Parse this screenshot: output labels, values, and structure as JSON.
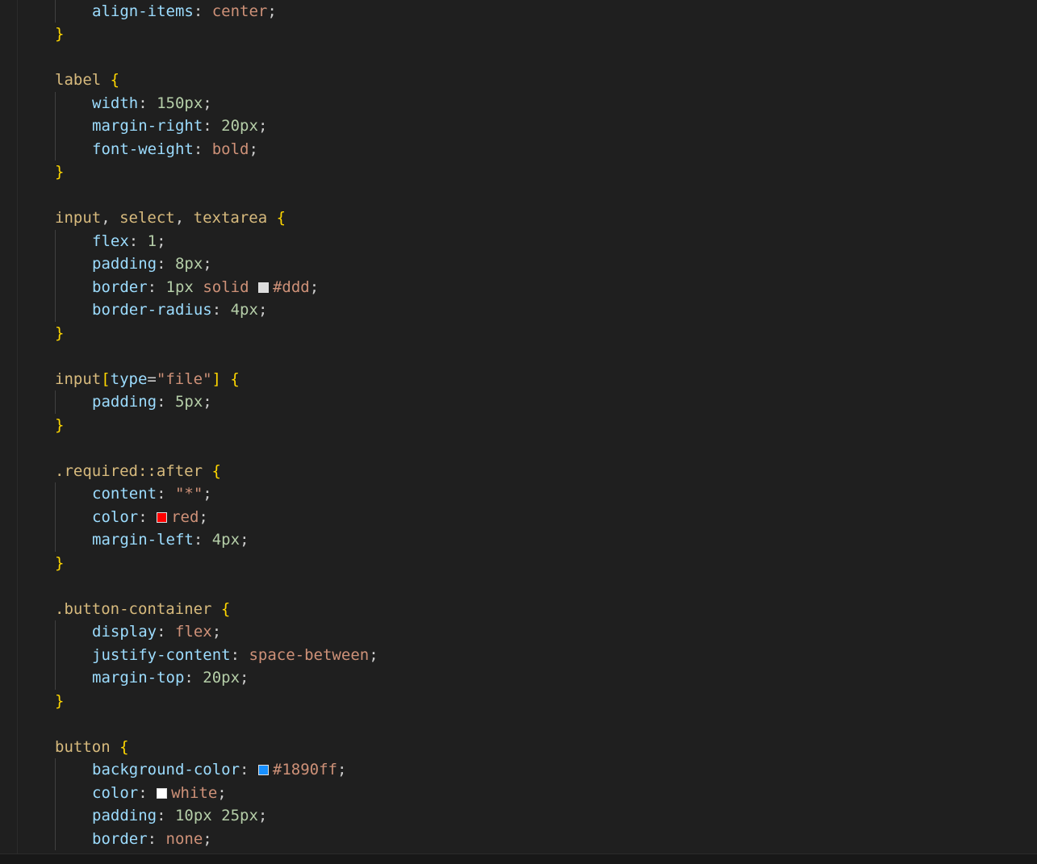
{
  "editor": {
    "language": "css",
    "lines": [
      {
        "id": "l0",
        "indent": 1,
        "tokens": [
          [
            "prop",
            "align-items"
          ],
          [
            "punc",
            ": "
          ],
          [
            "kw",
            "center"
          ],
          [
            "punc",
            ";"
          ]
        ]
      },
      {
        "id": "l1",
        "indent": 0,
        "tokens": [
          [
            "brace",
            "}"
          ]
        ]
      },
      {
        "id": "l2",
        "indent": 0,
        "tokens": []
      },
      {
        "id": "l3",
        "indent": 0,
        "tokens": [
          [
            "tag",
            "label"
          ],
          [
            "punc",
            " "
          ],
          [
            "brace",
            "{"
          ]
        ]
      },
      {
        "id": "l4",
        "indent": 1,
        "tokens": [
          [
            "prop",
            "width"
          ],
          [
            "punc",
            ": "
          ],
          [
            "num",
            "150px"
          ],
          [
            "punc",
            ";"
          ]
        ]
      },
      {
        "id": "l5",
        "indent": 1,
        "tokens": [
          [
            "prop",
            "margin-right"
          ],
          [
            "punc",
            ": "
          ],
          [
            "num",
            "20px"
          ],
          [
            "punc",
            ";"
          ]
        ]
      },
      {
        "id": "l6",
        "indent": 1,
        "tokens": [
          [
            "prop",
            "font-weight"
          ],
          [
            "punc",
            ": "
          ],
          [
            "kw",
            "bold"
          ],
          [
            "punc",
            ";"
          ]
        ]
      },
      {
        "id": "l7",
        "indent": 0,
        "tokens": [
          [
            "brace",
            "}"
          ]
        ]
      },
      {
        "id": "l8",
        "indent": 0,
        "tokens": []
      },
      {
        "id": "l9",
        "indent": 0,
        "tokens": [
          [
            "tag",
            "input"
          ],
          [
            "punc",
            ", "
          ],
          [
            "tag",
            "select"
          ],
          [
            "punc",
            ", "
          ],
          [
            "tag",
            "textarea"
          ],
          [
            "punc",
            " "
          ],
          [
            "brace",
            "{"
          ]
        ]
      },
      {
        "id": "l10",
        "indent": 1,
        "tokens": [
          [
            "prop",
            "flex"
          ],
          [
            "punc",
            ": "
          ],
          [
            "num",
            "1"
          ],
          [
            "punc",
            ";"
          ]
        ]
      },
      {
        "id": "l11",
        "indent": 1,
        "tokens": [
          [
            "prop",
            "padding"
          ],
          [
            "punc",
            ": "
          ],
          [
            "num",
            "8px"
          ],
          [
            "punc",
            ";"
          ]
        ]
      },
      {
        "id": "l12",
        "indent": 1,
        "tokens": [
          [
            "prop",
            "border"
          ],
          [
            "punc",
            ": "
          ],
          [
            "num",
            "1px"
          ],
          [
            "punc",
            " "
          ],
          [
            "kw",
            "solid"
          ],
          [
            "punc",
            " "
          ],
          [
            "swatch",
            "#dddddd"
          ],
          [
            "kw",
            "#ddd"
          ],
          [
            "punc",
            ";"
          ]
        ]
      },
      {
        "id": "l13",
        "indent": 1,
        "tokens": [
          [
            "prop",
            "border-radius"
          ],
          [
            "punc",
            ": "
          ],
          [
            "num",
            "4px"
          ],
          [
            "punc",
            ";"
          ]
        ]
      },
      {
        "id": "l14",
        "indent": 0,
        "tokens": [
          [
            "brace",
            "}"
          ]
        ]
      },
      {
        "id": "l15",
        "indent": 0,
        "tokens": []
      },
      {
        "id": "l16",
        "indent": 0,
        "tokens": [
          [
            "tag",
            "input"
          ],
          [
            "brace",
            "["
          ],
          [
            "attr",
            "type"
          ],
          [
            "punc",
            "="
          ],
          [
            "str",
            "\"file\""
          ],
          [
            "brace",
            "]"
          ],
          [
            "punc",
            " "
          ],
          [
            "brace",
            "{"
          ]
        ]
      },
      {
        "id": "l17",
        "indent": 1,
        "tokens": [
          [
            "prop",
            "padding"
          ],
          [
            "punc",
            ": "
          ],
          [
            "num",
            "5px"
          ],
          [
            "punc",
            ";"
          ]
        ]
      },
      {
        "id": "l18",
        "indent": 0,
        "tokens": [
          [
            "brace",
            "}"
          ]
        ]
      },
      {
        "id": "l19",
        "indent": 0,
        "tokens": []
      },
      {
        "id": "l20",
        "indent": 0,
        "tokens": [
          [
            "sel",
            ".required::after"
          ],
          [
            "punc",
            " "
          ],
          [
            "brace",
            "{"
          ]
        ]
      },
      {
        "id": "l21",
        "indent": 1,
        "tokens": [
          [
            "prop",
            "content"
          ],
          [
            "punc",
            ": "
          ],
          [
            "str",
            "\"*\""
          ],
          [
            "punc",
            ";"
          ]
        ]
      },
      {
        "id": "l22",
        "indent": 1,
        "tokens": [
          [
            "prop",
            "color"
          ],
          [
            "punc",
            ": "
          ],
          [
            "swatch",
            "#ff0000"
          ],
          [
            "kw",
            "red"
          ],
          [
            "punc",
            ";"
          ]
        ]
      },
      {
        "id": "l23",
        "indent": 1,
        "tokens": [
          [
            "prop",
            "margin-left"
          ],
          [
            "punc",
            ": "
          ],
          [
            "num",
            "4px"
          ],
          [
            "punc",
            ";"
          ]
        ]
      },
      {
        "id": "l24",
        "indent": 0,
        "tokens": [
          [
            "brace",
            "}"
          ]
        ]
      },
      {
        "id": "l25",
        "indent": 0,
        "tokens": []
      },
      {
        "id": "l26",
        "indent": 0,
        "tokens": [
          [
            "sel",
            ".button-container"
          ],
          [
            "punc",
            " "
          ],
          [
            "brace",
            "{"
          ]
        ]
      },
      {
        "id": "l27",
        "indent": 1,
        "tokens": [
          [
            "prop",
            "display"
          ],
          [
            "punc",
            ": "
          ],
          [
            "kw",
            "flex"
          ],
          [
            "punc",
            ";"
          ]
        ]
      },
      {
        "id": "l28",
        "indent": 1,
        "tokens": [
          [
            "prop",
            "justify-content"
          ],
          [
            "punc",
            ": "
          ],
          [
            "kw",
            "space-between"
          ],
          [
            "punc",
            ";"
          ]
        ]
      },
      {
        "id": "l29",
        "indent": 1,
        "tokens": [
          [
            "prop",
            "margin-top"
          ],
          [
            "punc",
            ": "
          ],
          [
            "num",
            "20px"
          ],
          [
            "punc",
            ";"
          ]
        ]
      },
      {
        "id": "l30",
        "indent": 0,
        "tokens": [
          [
            "brace",
            "}"
          ]
        ]
      },
      {
        "id": "l31",
        "indent": 0,
        "tokens": []
      },
      {
        "id": "l32",
        "indent": 0,
        "tokens": [
          [
            "tag",
            "button"
          ],
          [
            "punc",
            " "
          ],
          [
            "brace",
            "{"
          ]
        ]
      },
      {
        "id": "l33",
        "indent": 1,
        "tokens": [
          [
            "prop",
            "background-color"
          ],
          [
            "punc",
            ": "
          ],
          [
            "swatch",
            "#1890ff"
          ],
          [
            "kw",
            "#1890ff"
          ],
          [
            "punc",
            ";"
          ]
        ]
      },
      {
        "id": "l34",
        "indent": 1,
        "tokens": [
          [
            "prop",
            "color"
          ],
          [
            "punc",
            ": "
          ],
          [
            "swatch",
            "#ffffff"
          ],
          [
            "kw",
            "white"
          ],
          [
            "punc",
            ";"
          ]
        ]
      },
      {
        "id": "l35",
        "indent": 1,
        "tokens": [
          [
            "prop",
            "padding"
          ],
          [
            "punc",
            ": "
          ],
          [
            "num",
            "10px 25px"
          ],
          [
            "punc",
            ";"
          ]
        ]
      },
      {
        "id": "l36",
        "indent": 1,
        "tokens": [
          [
            "prop",
            "border"
          ],
          [
            "punc",
            ": "
          ],
          [
            "kw",
            "none"
          ],
          [
            "punc",
            ";"
          ]
        ]
      }
    ]
  },
  "colors": {
    "background": "#1f1f1f",
    "property": "#9cdcfe",
    "selector": "#d7ba7d",
    "brace": "#ffd700",
    "value_keyword": "#ce9178",
    "value_number": "#b5cea8"
  }
}
